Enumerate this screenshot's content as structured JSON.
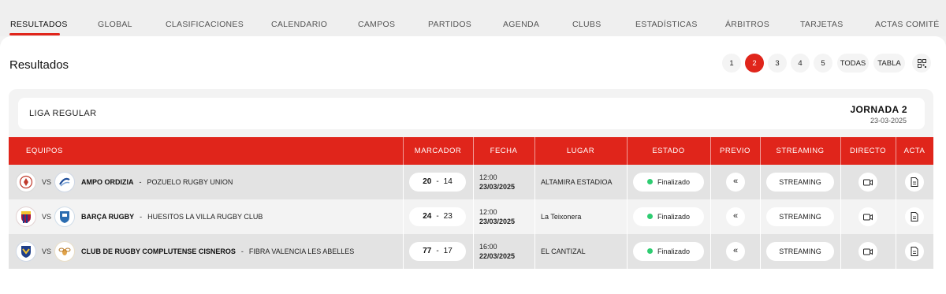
{
  "nav": {
    "tabs": [
      {
        "label": "RESULTADOS"
      },
      {
        "label": "GLOBAL"
      },
      {
        "label": "CLASIFICACIONES"
      },
      {
        "label": "CALENDARIO"
      },
      {
        "label": "CAMPOS"
      },
      {
        "label": "PARTIDOS"
      },
      {
        "label": "AGENDA"
      },
      {
        "label": "CLUBS"
      },
      {
        "label": "ESTADÍSTICAS"
      },
      {
        "label": "ÁRBITROS"
      },
      {
        "label": "TARJETAS"
      },
      {
        "label": "ACTAS COMITÉ"
      }
    ],
    "active_index": 0
  },
  "page": {
    "title": "Resultados"
  },
  "pagination": {
    "items": [
      "1",
      "2",
      "3",
      "4",
      "5",
      "TODAS",
      "TABLA"
    ],
    "active": "2",
    "qr_icon": "qr-code-icon"
  },
  "league": {
    "name": "LIGA REGULAR",
    "jornada": "JORNADA 2",
    "date": "23-03-2025"
  },
  "table": {
    "headers": [
      "EQUIPOS",
      "MARCADOR",
      "FECHA",
      "LUGAR",
      "ESTADO",
      "PREVIO",
      "STREAMING",
      "DIRECTO",
      "ACTA"
    ],
    "vs_label": "VS",
    "rows": [
      {
        "home": "AMPO ORDIZIA",
        "away": "POZUELO RUGBY UNION",
        "home_score": "20",
        "away_score": "14",
        "time": "12:00",
        "date": "23/03/2025",
        "venue": "ALTAMIRA ESTADIOA",
        "status": "Finalizado",
        "previo_icon": "double-chevron-left-icon",
        "streaming": "STREAMING",
        "directo_icon": "video-camera-icon",
        "acta_icon": "document-icon"
      },
      {
        "home": "BARÇA RUGBY",
        "away": "HUESITOS LA VILLA RUGBY CLUB",
        "home_score": "24",
        "away_score": "23",
        "time": "12:00",
        "date": "23/03/2025",
        "venue": "La Teixonera",
        "status": "Finalizado",
        "previo_icon": "double-chevron-left-icon",
        "streaming": "STREAMING",
        "directo_icon": "video-camera-icon",
        "acta_icon": "document-icon"
      },
      {
        "home": "CLUB DE RUGBY COMPLUTENSE CISNEROS",
        "away": "FIBRA VALENCIA LES ABELLES",
        "home_score": "77",
        "away_score": "17",
        "time": "16:00",
        "date": "22/03/2025",
        "venue": "EL CANTIZAL",
        "status": "Finalizado",
        "previo_icon": "double-chevron-left-icon",
        "streaming": "STREAMING",
        "directo_icon": "video-camera-icon",
        "acta_icon": "document-icon"
      }
    ]
  },
  "colors": {
    "accent": "#e0251b",
    "status_ok": "#2ecc71"
  }
}
